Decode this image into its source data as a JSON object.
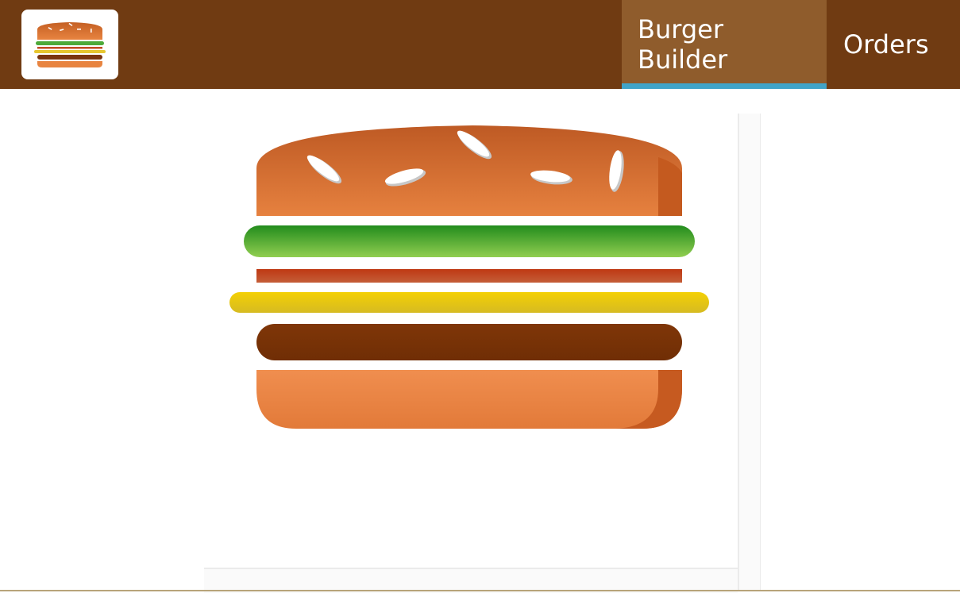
{
  "header": {
    "logo_icon": "burger-logo-icon",
    "nav": [
      {
        "label": "Burger Builder",
        "active": true
      },
      {
        "label": "Orders",
        "active": false
      }
    ]
  },
  "burger": {
    "layers": [
      "bread-top",
      "salad",
      "bacon",
      "cheese",
      "meat",
      "bread-bottom"
    ]
  },
  "colors": {
    "toolbar": "#703B12",
    "active_nav": "#8F5C2C",
    "active_indicator": "#40A4C8",
    "bread": "#E27B36",
    "salad": "#228C1D",
    "bacon": "#BF3813",
    "cheese": "#F4D004",
    "meat": "#7F3608"
  }
}
